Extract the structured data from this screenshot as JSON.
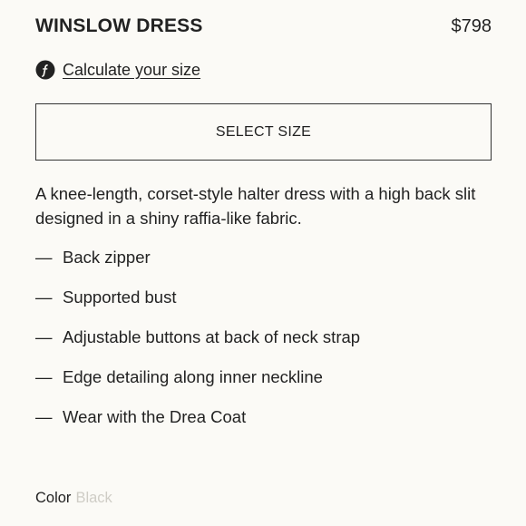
{
  "product": {
    "title": "WINSLOW DRESS",
    "price": "$798"
  },
  "size_calculator": {
    "icon": "fit-predictor-icon",
    "label": "Calculate your size"
  },
  "size_select": {
    "label": "SELECT SIZE"
  },
  "description": "A knee-length, corset-style halter dress with a high back slit designed in a shiny raffia-like fabric.",
  "features": [
    {
      "dash": "—",
      "text": "Back zipper"
    },
    {
      "dash": "—",
      "text": "Supported bust"
    },
    {
      "dash": "—",
      "text": "Adjustable buttons at back of neck strap"
    },
    {
      "dash": "—",
      "text": "Edge detailing along inner neckline"
    },
    {
      "dash": "—",
      "text": "Wear with the Drea Coat"
    }
  ],
  "color": {
    "label": "Color",
    "value": "Black"
  },
  "colors": {
    "text": "#222222",
    "background": "#fbfaf6",
    "muted": "#cfcdc6"
  }
}
